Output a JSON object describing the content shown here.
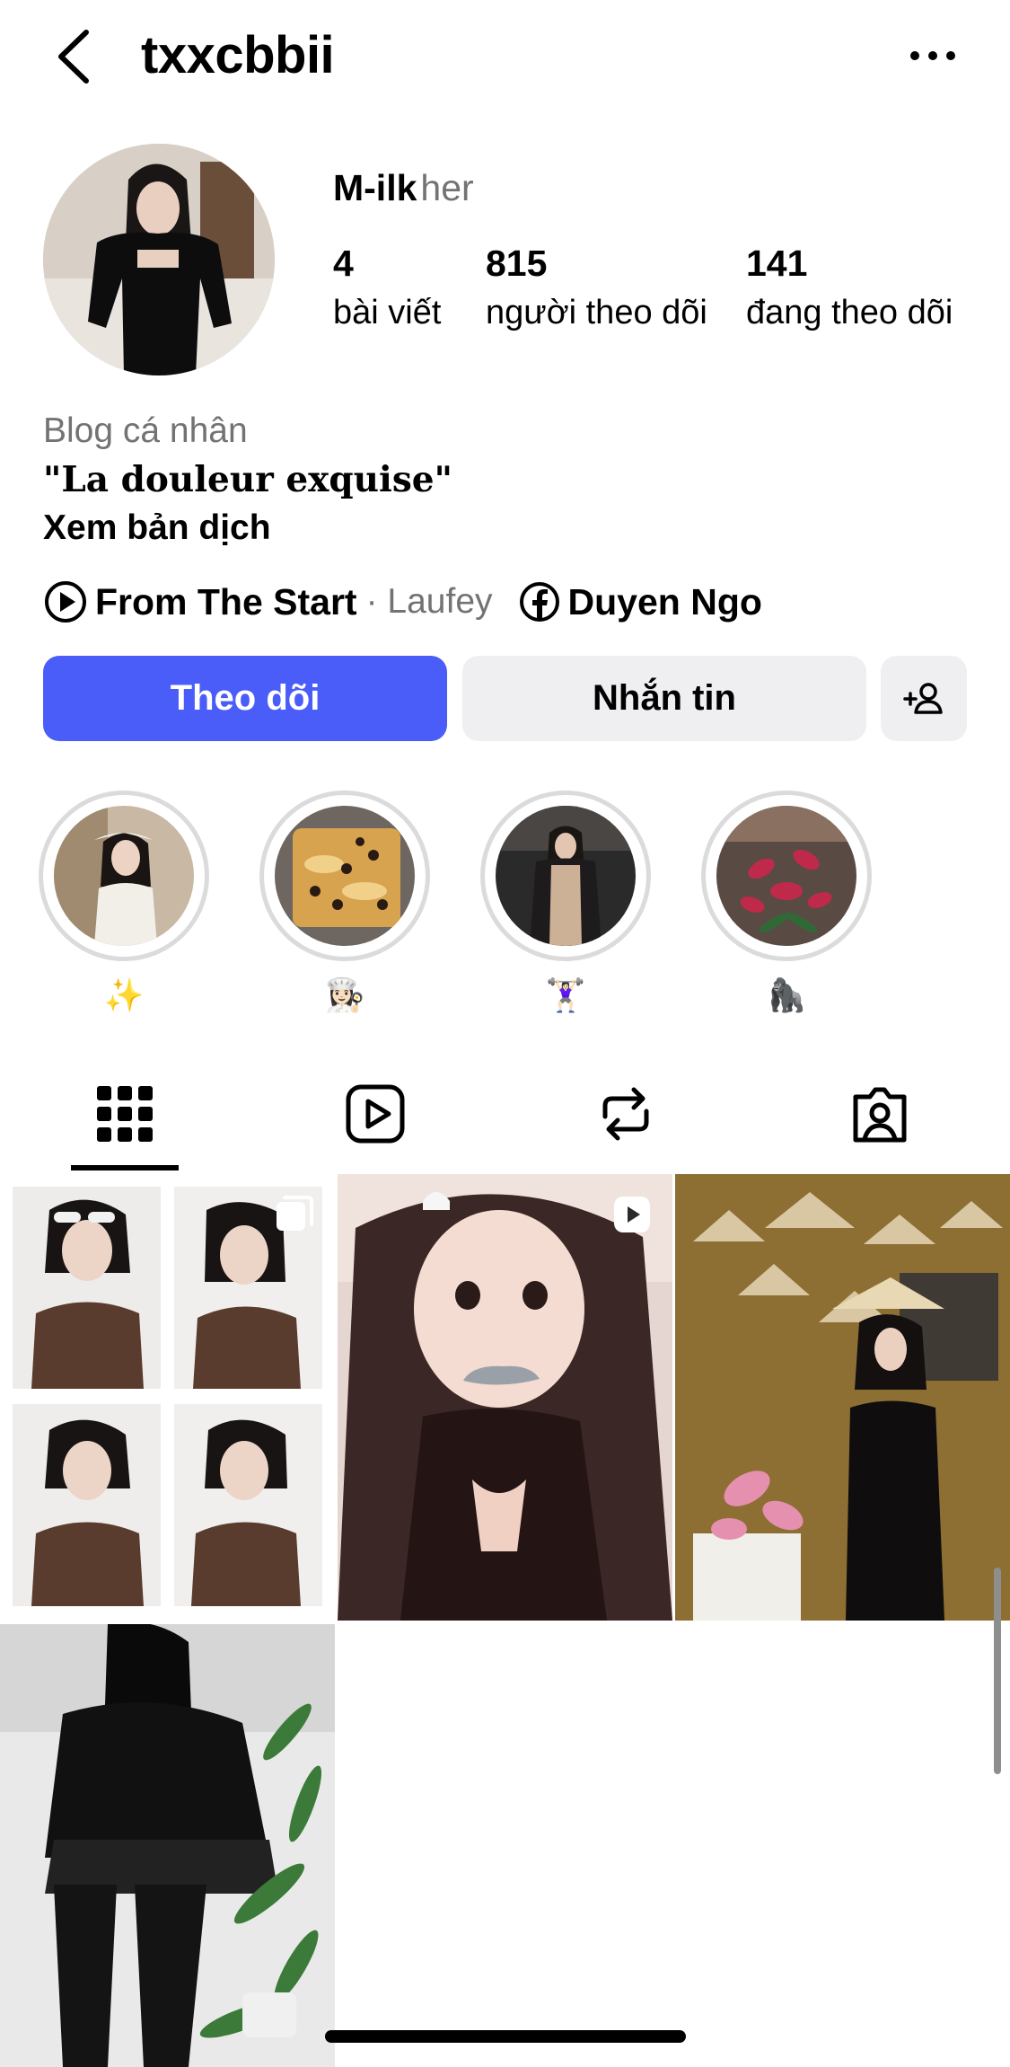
{
  "header": {
    "username": "txxcbbii"
  },
  "profile": {
    "name": "M-ilk",
    "pronouns": "her",
    "stats": {
      "posts_count": "4",
      "posts_label": "bài viết",
      "followers_count": "815",
      "followers_label": "người theo dõi",
      "following_count": "141",
      "following_label": "đang theo dõi"
    },
    "category": "Blog cá nhân",
    "bio": "\"La douleur exquise\"",
    "translate_label": "Xem bản dịch",
    "music": {
      "song": "From The Start",
      "artist": "· Laufey"
    },
    "facebook_name": "Duyen Ngo"
  },
  "actions": {
    "follow_label": "Theo dõi",
    "message_label": "Nhắn tin"
  },
  "highlights": [
    {
      "label": "✨"
    },
    {
      "label": "👩🏻‍🍳"
    },
    {
      "label": "🏋🏻‍♀️"
    },
    {
      "label": "🦍"
    }
  ],
  "tabs": [
    "grid-icon",
    "reels-icon",
    "repost-icon",
    "tagged-icon"
  ],
  "colors": {
    "accent": "#4a5df9",
    "secondary_button": "#efeff2",
    "muted_text": "#737373"
  }
}
